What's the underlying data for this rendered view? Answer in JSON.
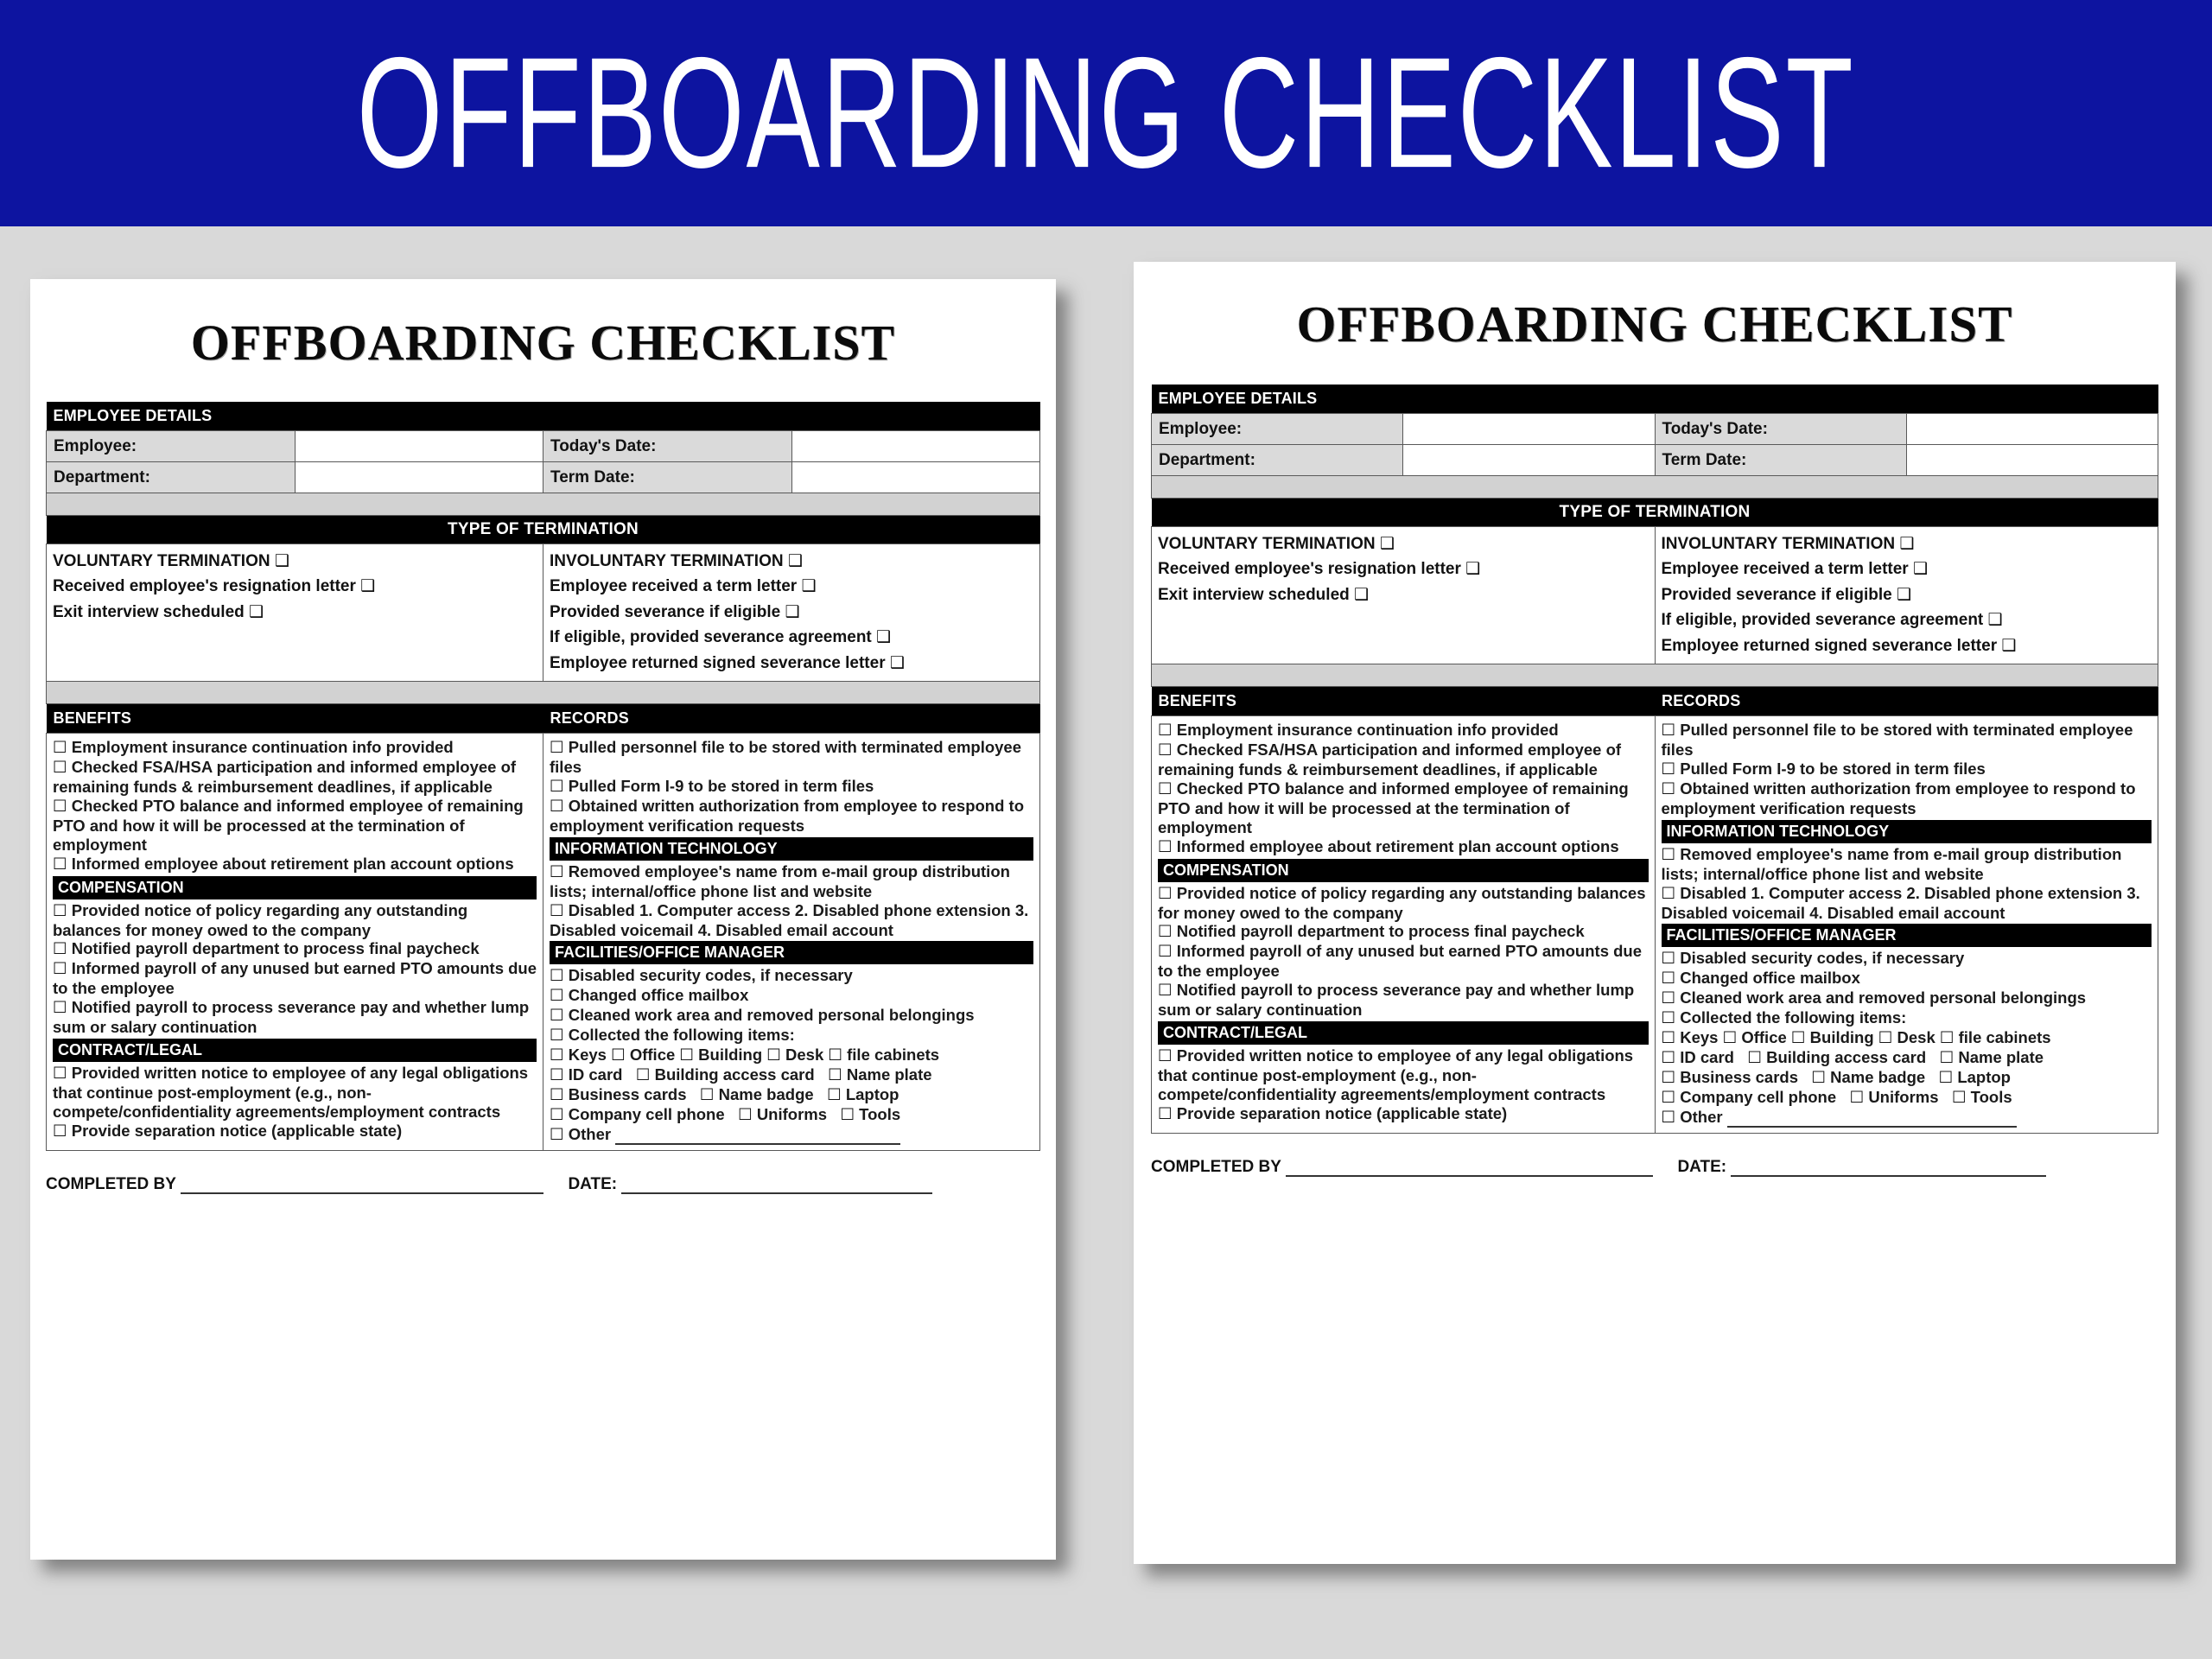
{
  "banner": {
    "title": "OFFBOARDING CHECKLIST"
  },
  "document": {
    "title": "OFFBOARDING CHECKLIST",
    "employee_details": {
      "header": "EMPLOYEE DETAILS",
      "fields": [
        {
          "label": "Employee:",
          "value": ""
        },
        {
          "label": "Today's Date:",
          "value": ""
        },
        {
          "label": "Department:",
          "value": ""
        },
        {
          "label": "Term Date:",
          "value": ""
        }
      ]
    },
    "type_of_termination": {
      "header": "TYPE OF TERMINATION",
      "voluntary": {
        "title": "VOLUNTARY TERMINATION",
        "items": [
          "Received employee's resignation letter",
          "Exit interview scheduled"
        ]
      },
      "involuntary": {
        "title": "INVOLUNTARY TERMINATION",
        "items": [
          "Employee received a term letter",
          "Provided severance if eligible",
          "If eligible, provided severance agreement",
          "Employee returned signed severance letter"
        ]
      }
    },
    "columns": {
      "left_header": "BENEFITS",
      "right_header": "RECORDS",
      "benefits_items": [
        "Employment insurance continuation info provided",
        "Checked FSA/HSA participation and informed employee of remaining funds & reimbursement deadlines, if applicable",
        "Checked PTO balance and informed employee of remaining PTO and how it will be processed at the termination of employment",
        "Informed employee about retirement plan account options"
      ],
      "compensation_header": "COMPENSATION",
      "compensation_items": [
        "Provided notice of policy regarding any outstanding balances for money owed to the company",
        "Notified payroll department to process final paycheck",
        "Informed payroll of any unused but earned PTO amounts due to the employee",
        "Notified payroll to process severance pay and whether lump sum or salary continuation"
      ],
      "contract_header": "CONTRACT/LEGAL",
      "contract_items": [
        "Provided written notice to employee of any legal obligations that continue post-employment (e.g., non-compete/confidentiality agreements/employment contracts",
        "Provide separation notice (applicable state)"
      ],
      "records_items": [
        "Pulled personnel file to be stored with terminated employee files",
        "Pulled Form I-9 to be stored in term files",
        "Obtained written authorization from employee to respond to employment verification requests"
      ],
      "it_header": "INFORMATION TECHNOLOGY",
      "it_items": [
        "Removed employee's name from e-mail group distribution lists; internal/office phone list and website",
        "Disabled 1. Computer access 2. Disabled phone extension 3. Disabled voicemail 4. Disabled email account"
      ],
      "facilities_header": "FACILITIES/OFFICE MANAGER",
      "facilities_items": [
        "Disabled security codes, if necessary",
        "Changed office mailbox",
        "Cleaned work area and removed personal belongings",
        "Collected the following items:"
      ],
      "collected_rows": [
        [
          "Keys",
          "Office",
          "Building",
          "Desk",
          "file cabinets"
        ],
        [
          "ID card",
          "Building access card",
          "Name plate"
        ],
        [
          "Business cards",
          "Name badge",
          "Laptop"
        ],
        [
          "Company cell phone",
          "Uniforms",
          "Tools"
        ]
      ],
      "other_label": "Other"
    },
    "footer": {
      "completed_by_label": "COMPLETED BY",
      "date_label": "DATE:"
    }
  },
  "icons": {
    "checkbox": "☐",
    "checkbox_bold": "☐"
  },
  "colors": {
    "banner_blue": "#0d14a0",
    "band_black": "#000000",
    "page_bg": "#d9d9d9",
    "label_gray": "#dadada"
  }
}
